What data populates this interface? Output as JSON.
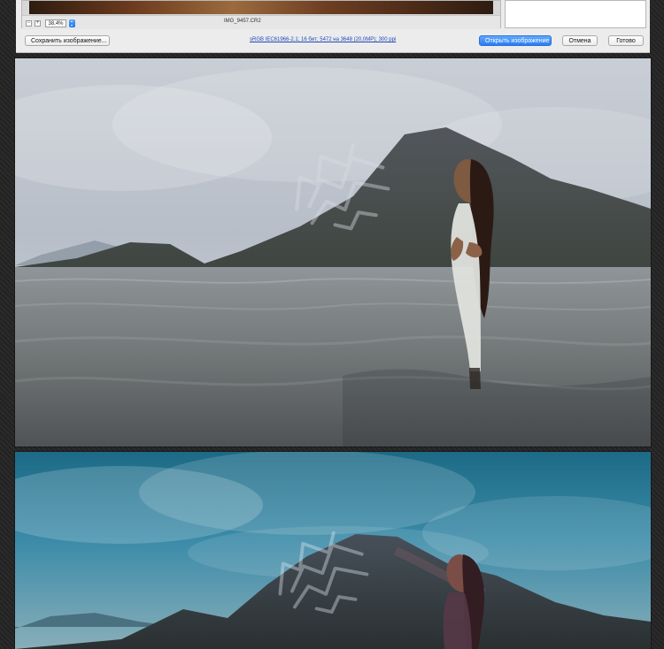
{
  "dialog": {
    "zoom_value": "38,4%",
    "filename": "IMG_9457.CR2",
    "save_button": "Сохранить изображение...",
    "workflow_text": "sRGB IEC61966-2.1; 16 бит; 5472 на 3648 (20,0MP); 300 ppi",
    "open_button": "Открыть изображение",
    "cancel_button": "Отмена",
    "done_button": "Готово"
  },
  "photos": [
    {
      "name": "before-photo"
    },
    {
      "name": "after-photo"
    }
  ],
  "colors": {
    "dialog_bg": "#ececec",
    "accent": "#2a7df0",
    "link": "#1e49b8",
    "page_bg": "#2a2a2a"
  }
}
